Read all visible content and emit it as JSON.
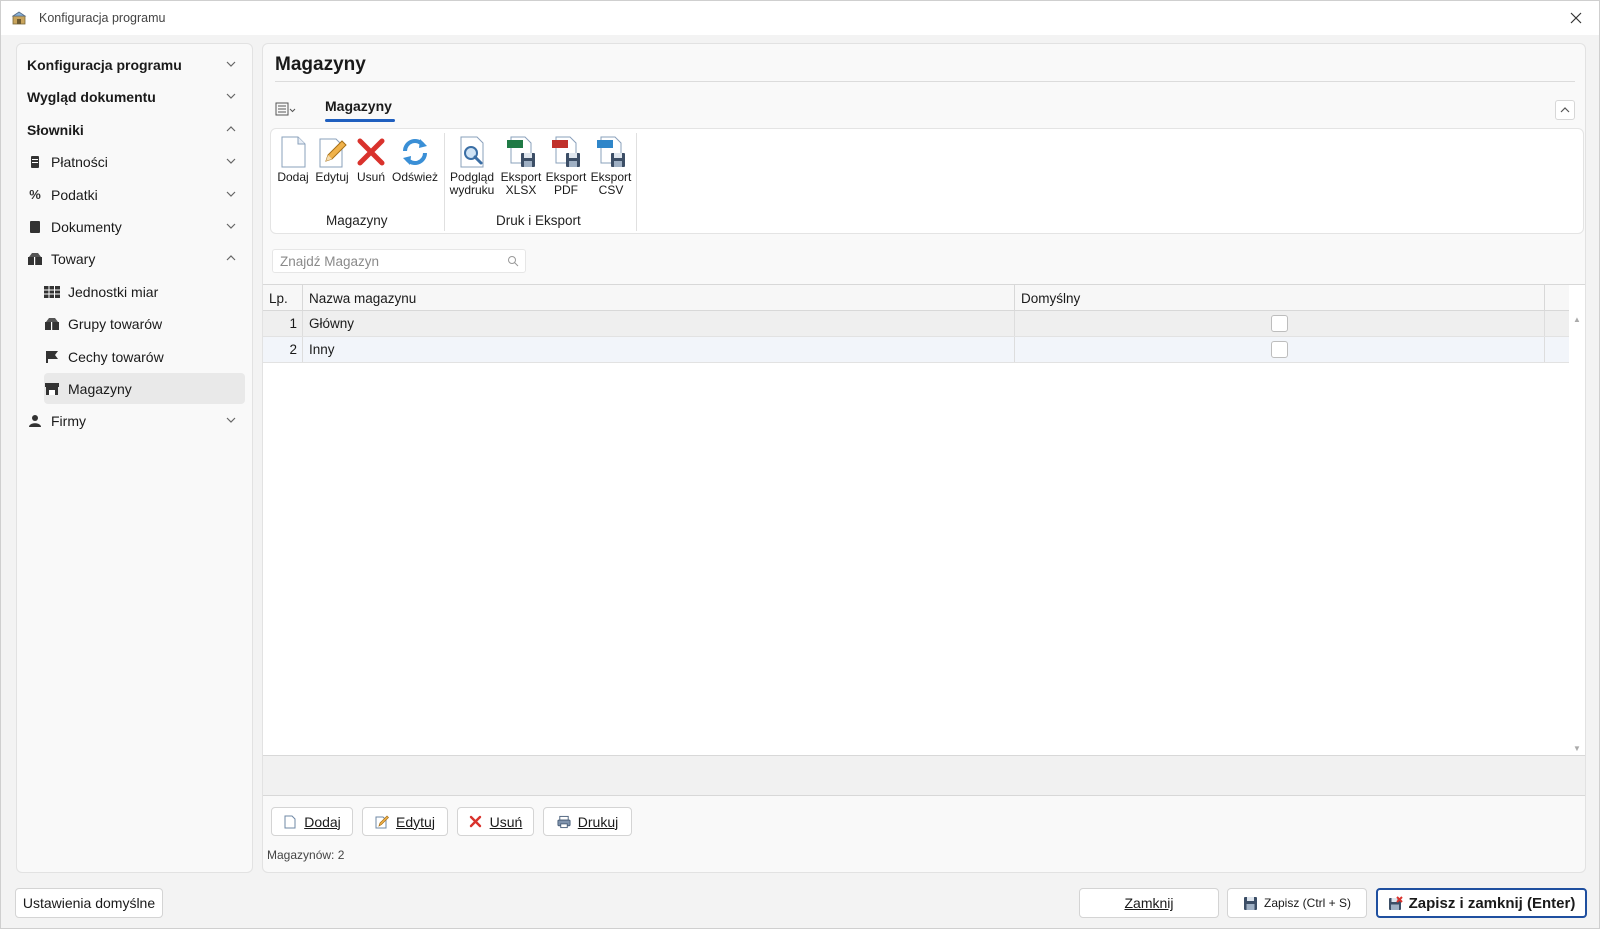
{
  "window": {
    "title": "Konfiguracja programu",
    "close_icon": "close-icon",
    "app_icon": "app-icon"
  },
  "sidebar": {
    "items": [
      {
        "label": "Konfiguracja programu",
        "bold": true,
        "expanded": false
      },
      {
        "label": "Wygląd dokumentu",
        "bold": true,
        "expanded": false
      },
      {
        "label": "Słowniki",
        "bold": true,
        "expanded": true
      },
      {
        "label": "Płatności",
        "icon": "money-icon",
        "expanded": false
      },
      {
        "label": "Podatki",
        "icon": "percent-icon",
        "expanded": false
      },
      {
        "label": "Dokumenty",
        "icon": "document-icon",
        "expanded": false
      },
      {
        "label": "Towary",
        "icon": "boxes-icon",
        "expanded": true
      },
      {
        "label": "Jednostki miar",
        "icon": "table-icon"
      },
      {
        "label": "Grupy towarów",
        "icon": "boxes-icon"
      },
      {
        "label": "Cechy towarów",
        "icon": "flag-icon"
      },
      {
        "label": "Magazyny",
        "icon": "warehouse-icon",
        "active": true
      },
      {
        "label": "Firmy",
        "icon": "person-icon",
        "expanded": false
      }
    ]
  },
  "main": {
    "title": "Magazyny",
    "ribbon_tab": "Magazyny",
    "ribbon": {
      "groups": [
        {
          "label": "Magazyny",
          "buttons": [
            {
              "label": "Dodaj",
              "icon": "new-document-icon"
            },
            {
              "label": "Edytuj",
              "icon": "edit-icon"
            },
            {
              "label": "Usuń",
              "icon": "delete-icon"
            },
            {
              "label": "Odśwież",
              "icon": "refresh-icon"
            }
          ]
        },
        {
          "label": "Druk i Eksport",
          "buttons": [
            {
              "label": "Podgląd wydruku",
              "line1": "Podgląd",
              "line2": "wydruku",
              "icon": "print-preview-icon"
            },
            {
              "label": "Eksport XLSX",
              "line1": "Eksport",
              "line2": "XLSX",
              "icon": "export-xlsx-icon"
            },
            {
              "label": "Eksport PDF",
              "line1": "Eksport",
              "line2": "PDF",
              "icon": "export-pdf-icon"
            },
            {
              "label": "Eksport CSV",
              "line1": "Eksport",
              "line2": "CSV",
              "icon": "export-csv-icon"
            }
          ]
        }
      ]
    },
    "search": {
      "placeholder": "Znajdź Magazyn",
      "value": ""
    },
    "grid": {
      "columns": [
        "Lp.",
        "Nazwa magazynu",
        "Domyślny"
      ],
      "rows": [
        {
          "lp": "1",
          "name": "Główny",
          "default": false
        },
        {
          "lp": "2",
          "name": "Inny",
          "default": false
        }
      ]
    },
    "actions": {
      "add": "Dodaj",
      "edit": "Edytuj",
      "delete": "Usuń",
      "print": "Drukuj"
    },
    "status": "Magazynów: 2"
  },
  "footer": {
    "defaults": "Ustawienia domyślne",
    "close": "Zamknij",
    "save": "Zapisz (Ctrl + S)",
    "save_close": "Zapisz i zamknij (Enter)"
  },
  "colors": {
    "accent": "#1f5fbf",
    "primary_border": "#1f4f9f",
    "delete_red": "#d9322c"
  }
}
